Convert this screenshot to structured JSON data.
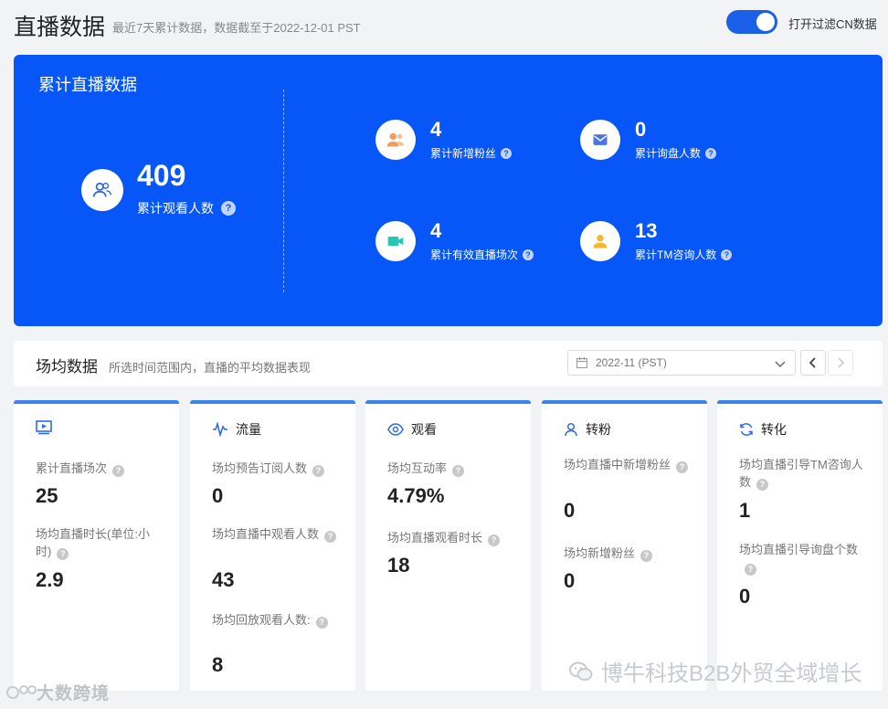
{
  "header": {
    "title": "直播数据",
    "subtitle": "最近7天累计数据，数据截至于2022-12-01 PST",
    "toggle_label": "打开过滤CN数据",
    "toggle_on": true
  },
  "summary": {
    "title": "累计直播数据",
    "main": {
      "value": "409",
      "label": "累计观看人数",
      "icon": "users-icon"
    },
    "metrics": [
      {
        "value": "4",
        "label": "累计新增粉丝",
        "icon": "fans-icon"
      },
      {
        "value": "0",
        "label": "累计询盘人数",
        "icon": "mail-icon"
      },
      {
        "value": "4",
        "label": "累计有效直播场次",
        "icon": "video-icon"
      },
      {
        "value": "13",
        "label": "累计TM咨询人数",
        "icon": "user-icon"
      }
    ]
  },
  "session": {
    "title": "场均数据",
    "subtitle": "所选时间范围内，直播的平均数据表现",
    "date": "2022-11 (PST)"
  },
  "cards": [
    {
      "title": "",
      "icon": "play-icon",
      "stats": [
        {
          "label": "累计直播场次",
          "value": "25"
        },
        {
          "label": "场均直播时长(单位:小时)",
          "value": "2.9"
        }
      ]
    },
    {
      "title": "流量",
      "icon": "pulse-icon",
      "stats": [
        {
          "label": "场均预告订阅人数",
          "value": "0"
        },
        {
          "label": "场均直播中观看人数",
          "value": "43"
        },
        {
          "label": "场均回放观看人数:",
          "value": "8"
        }
      ]
    },
    {
      "title": "观看",
      "icon": "eye-icon",
      "stats": [
        {
          "label": "场均互动率",
          "value": "4.79%"
        },
        {
          "label": "场均直播观看时长",
          "value": "18"
        }
      ]
    },
    {
      "title": "转粉",
      "icon": "person-icon",
      "stats": [
        {
          "label": "场均直播中新增粉丝",
          "value": "0"
        },
        {
          "label": "场均新增粉丝",
          "value": "0"
        }
      ]
    },
    {
      "title": "转化",
      "icon": "refresh-icon",
      "stats": [
        {
          "label": "场均直播引导TM咨询人数",
          "value": "1"
        },
        {
          "label": "场均直播引导询盘个数",
          "value": "0"
        }
      ]
    }
  ],
  "watermarks": {
    "left": "大数跨境",
    "right": "博牛科技B2B外贸全域增长"
  },
  "colors": {
    "accent": "#0756f8",
    "card_top": "#3d83ee",
    "fans": "#f39b5b",
    "mail": "#4b74e6",
    "video": "#27c7b5",
    "user": "#f5b731"
  }
}
